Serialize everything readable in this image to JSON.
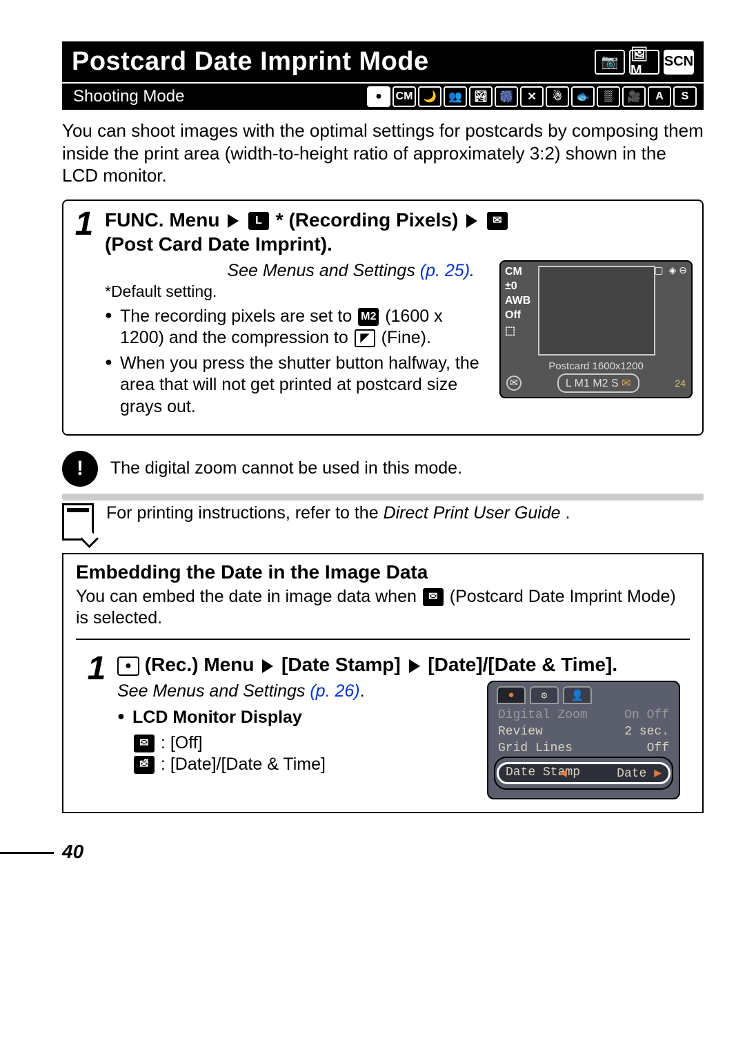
{
  "title": "Postcard Date Imprint Mode",
  "title_modes": [
    "📷",
    "🖼M",
    "SCN"
  ],
  "shooting_mode_label": "Shooting Mode",
  "shooting_icons": [
    "●",
    "CM",
    "🌙",
    "👥",
    "🏞",
    "🎆",
    "✕",
    "☃",
    "🐟",
    "▒",
    "🎥",
    "A",
    "S"
  ],
  "intro": "You can shoot images with the optimal settings for postcards by composing them inside the print area (width-to-height ratio of approximately 3:2) shown in the LCD monitor.",
  "step1": {
    "num": "1",
    "head_a": "FUNC. Menu",
    "head_b": "* (Recording Pixels)",
    "head_c": "(Post Card Date Imprint).",
    "see": "See Menus and Settings",
    "see_pg": "(p. 25)",
    "default": "*Default setting.",
    "bullets": [
      {
        "pre": "The recording pixels are set to ",
        "mid": "M2",
        "post": " (1600 x 1200) and the compression to ",
        "icon": "◤",
        "tail": "(Fine)."
      },
      {
        "text": "When you press the shutter button halfway, the area that will not get printed at postcard size grays out."
      }
    ],
    "lcd": {
      "left": [
        "CM",
        "±0",
        "AWB",
        "Off",
        "⬚"
      ],
      "top_right": [
        "▢",
        "◈ ⊖"
      ],
      "postcard": "Postcard 1600x1200",
      "sizes": "L  M1 M2 S",
      "count": "24"
    }
  },
  "note1": "The digital zoom cannot be used in this mode.",
  "note2_a": "For printing instructions, refer to the ",
  "note2_b": "Direct Print User Guide",
  "note2_c": ".",
  "embed": {
    "title": "Embedding the Date in the Image Data",
    "intro_a": "You can embed the date in image data when ",
    "intro_b": " (Postcard Date Imprint Mode) is selected.",
    "step_num": "1",
    "head_a": "(Rec.) Menu",
    "head_b": "[Date Stamp]",
    "head_c": "[Date]/[Date & Time].",
    "see": "See Menus and Settings",
    "see_pg": "(p. 26)",
    "lcd_heading": "LCD Monitor Display",
    "off_label": ": [Off]",
    "date_label": ": [Date]/[Date & Time]",
    "menu": {
      "tabs": [
        "●",
        "⚙",
        "👤"
      ],
      "rows": [
        {
          "k": "Digital Zoom",
          "v": "On Off"
        },
        {
          "k": "Review",
          "v": "2 sec."
        },
        {
          "k": "Grid Lines",
          "v": "Off"
        }
      ],
      "sel": {
        "k": "Date Stamp",
        "v": "Date"
      }
    }
  },
  "page_number": "40"
}
